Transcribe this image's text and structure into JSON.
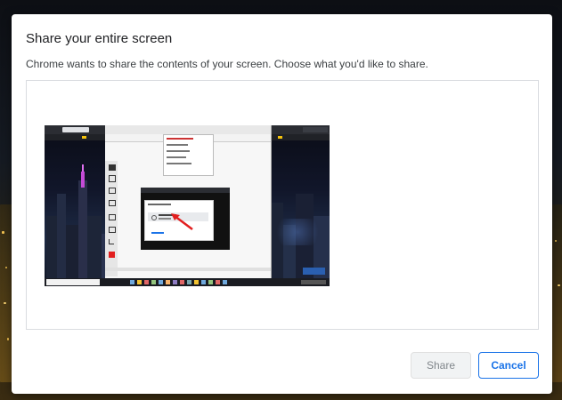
{
  "dialog": {
    "title": "Share your entire screen",
    "description": "Chrome wants to share the contents of your screen. Choose what you'd like to share.",
    "share_label": "Share",
    "cancel_label": "Cancel"
  },
  "colors": {
    "accent": "#1a73e8",
    "disabled_text": "#80868b",
    "disabled_bg": "#f1f3f4"
  }
}
